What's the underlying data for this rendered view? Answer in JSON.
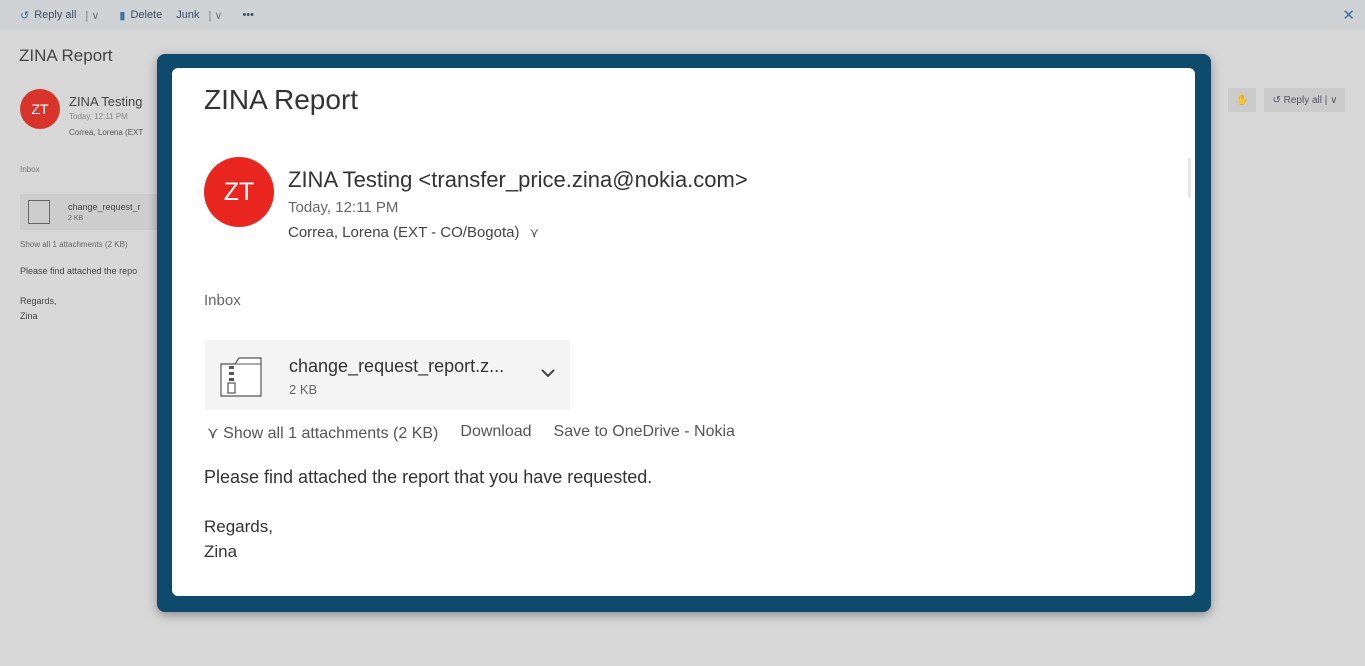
{
  "background": {
    "toolbar": {
      "reply_all": "Reply all",
      "delete": "Delete",
      "junk": "Junk",
      "more": "•••"
    },
    "title": "ZINA Report",
    "avatar": "ZT",
    "sender": "ZINA Testing",
    "time": "Today, 12:11 PM",
    "to": "Correa, Lorena (EXT",
    "folder": "Inbox",
    "attachment_name": "change_request_r",
    "attachment_size": "2 KB",
    "show_all": "Show all 1 attachments (2 KB)",
    "body_line": "Please find attached the repo",
    "regards": "Regards,",
    "signature": "Zina",
    "reply_all_right": "Reply all"
  },
  "message": {
    "subject": "ZINA Report",
    "avatar_initials": "ZT",
    "avatar_color": "#e8251f",
    "sender": "ZINA Testing <transfer_price.zina@nokia.com>",
    "sent_time": "Today, 12:11 PM",
    "recipients": "Correa, Lorena (EXT - CO/Bogota)",
    "folder": "Inbox",
    "attachment": {
      "name": "change_request_report.z...",
      "size": "2 KB"
    },
    "actions": {
      "show_all": "Show all 1 attachments (2 KB)",
      "download": "Download",
      "save": "Save to OneDrive - Nokia"
    },
    "body": "Please find attached the report that you have requested.",
    "regards": "Regards,",
    "signature": "Zina"
  },
  "colors": {
    "frame": "#0e4a6c",
    "avatar": "#e8251f"
  }
}
